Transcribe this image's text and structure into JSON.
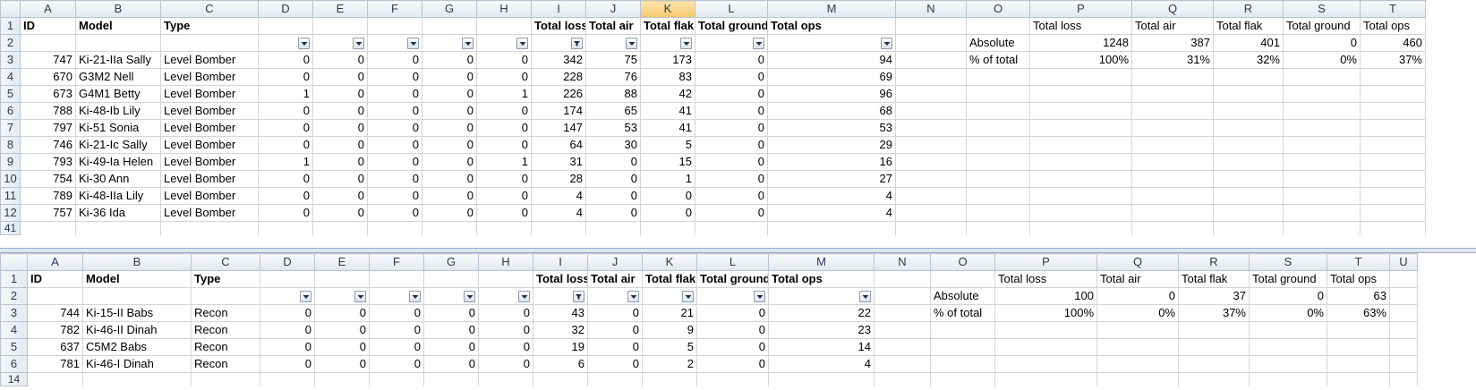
{
  "top": {
    "columns": [
      "A",
      "B",
      "C",
      "D",
      "E",
      "F",
      "G",
      "H",
      "I",
      "J",
      "K",
      "L",
      "M",
      "N",
      "O",
      "P",
      "Q",
      "R",
      "S",
      "T"
    ],
    "selected_column": "K",
    "row_numbers": [
      "1",
      "2",
      "3",
      "4",
      "5",
      "6",
      "7",
      "8",
      "9",
      "10",
      "11",
      "12",
      "41"
    ],
    "headers": {
      "A": "ID",
      "B": "Model",
      "C": "Type",
      "I": "Total loss",
      "J": "Total air",
      "K": "Total flak",
      "L": "Total ground",
      "M": "Total ops"
    },
    "summary_headers": {
      "P": "Total loss",
      "Q": "Total air",
      "R": "Total flak",
      "S": "Total ground",
      "T": "Total ops"
    },
    "summary_rows": [
      {
        "label": "Absolute",
        "P": "1248",
        "Q": "387",
        "R": "401",
        "S": "0",
        "T": "460"
      },
      {
        "label": "% of total",
        "P": "100%",
        "Q": "31%",
        "R": "32%",
        "S": "0%",
        "T": "37%"
      }
    ],
    "data_rows": [
      [
        "747",
        "Ki-21-IIa Sally",
        "Level Bomber",
        "0",
        "0",
        "0",
        "0",
        "0",
        "342",
        "75",
        "173",
        "0",
        "94"
      ],
      [
        "670",
        "G3M2 Nell",
        "Level Bomber",
        "0",
        "0",
        "0",
        "0",
        "0",
        "228",
        "76",
        "83",
        "0",
        "69"
      ],
      [
        "673",
        "G4M1 Betty",
        "Level Bomber",
        "1",
        "0",
        "0",
        "0",
        "1",
        "226",
        "88",
        "42",
        "0",
        "96"
      ],
      [
        "788",
        "Ki-48-Ib Lily",
        "Level Bomber",
        "0",
        "0",
        "0",
        "0",
        "0",
        "174",
        "65",
        "41",
        "0",
        "68"
      ],
      [
        "797",
        "Ki-51 Sonia",
        "Level Bomber",
        "0",
        "0",
        "0",
        "0",
        "0",
        "147",
        "53",
        "41",
        "0",
        "53"
      ],
      [
        "746",
        "Ki-21-Ic Sally",
        "Level Bomber",
        "0",
        "0",
        "0",
        "0",
        "0",
        "64",
        "30",
        "5",
        "0",
        "29"
      ],
      [
        "793",
        "Ki-49-Ia Helen",
        "Level Bomber",
        "1",
        "0",
        "0",
        "0",
        "1",
        "31",
        "0",
        "15",
        "0",
        "16"
      ],
      [
        "754",
        "Ki-30 Ann",
        "Level Bomber",
        "0",
        "0",
        "0",
        "0",
        "0",
        "28",
        "0",
        "1",
        "0",
        "27"
      ],
      [
        "789",
        "Ki-48-IIa Lily",
        "Level Bomber",
        "0",
        "0",
        "0",
        "0",
        "0",
        "4",
        "0",
        "0",
        "0",
        "4"
      ],
      [
        "757",
        "Ki-36 Ida",
        "Level Bomber",
        "0",
        "0",
        "0",
        "0",
        "0",
        "4",
        "0",
        "0",
        "0",
        "4"
      ]
    ]
  },
  "bottom": {
    "columns": [
      "A",
      "B",
      "C",
      "D",
      "E",
      "F",
      "G",
      "H",
      "I",
      "J",
      "K",
      "L",
      "M",
      "N",
      "O",
      "P",
      "Q",
      "R",
      "S",
      "T",
      "U"
    ],
    "row_numbers": [
      "1",
      "2",
      "3",
      "4",
      "5",
      "6",
      "14"
    ],
    "headers": {
      "A": "ID",
      "B": "Model",
      "C": "Type",
      "I": "Total loss",
      "J": "Total air",
      "K": "Total flak",
      "L": "Total ground",
      "M": "Total ops"
    },
    "summary_headers": {
      "P": "Total loss",
      "Q": "Total air",
      "R": "Total flak",
      "S": "Total ground",
      "T": "Total ops"
    },
    "summary_rows": [
      {
        "label": "Absolute",
        "P": "100",
        "Q": "0",
        "R": "37",
        "S": "0",
        "T": "63"
      },
      {
        "label": "% of total",
        "P": "100%",
        "Q": "0%",
        "R": "37%",
        "S": "0%",
        "T": "63%"
      }
    ],
    "data_rows": [
      [
        "744",
        "Ki-15-II Babs",
        "Recon",
        "0",
        "0",
        "0",
        "0",
        "0",
        "43",
        "0",
        "21",
        "0",
        "22"
      ],
      [
        "782",
        "Ki-46-II Dinah",
        "Recon",
        "0",
        "0",
        "0",
        "0",
        "0",
        "32",
        "0",
        "9",
        "0",
        "23"
      ],
      [
        "637",
        "C5M2 Babs",
        "Recon",
        "0",
        "0",
        "0",
        "0",
        "0",
        "19",
        "0",
        "5",
        "0",
        "14"
      ],
      [
        "781",
        "Ki-46-I Dinah",
        "Recon",
        "0",
        "0",
        "0",
        "0",
        "0",
        "6",
        "0",
        "2",
        "0",
        "4"
      ]
    ]
  },
  "icons": {
    "filter": "filter-dropdown-icon",
    "filter_active": "filter-applied-icon"
  },
  "colors": {
    "header_bg": "#e3e8ef",
    "selected_header": "#f6c66b",
    "gridline": "#d4d4d4",
    "row_number_text": "#2a3a52"
  }
}
